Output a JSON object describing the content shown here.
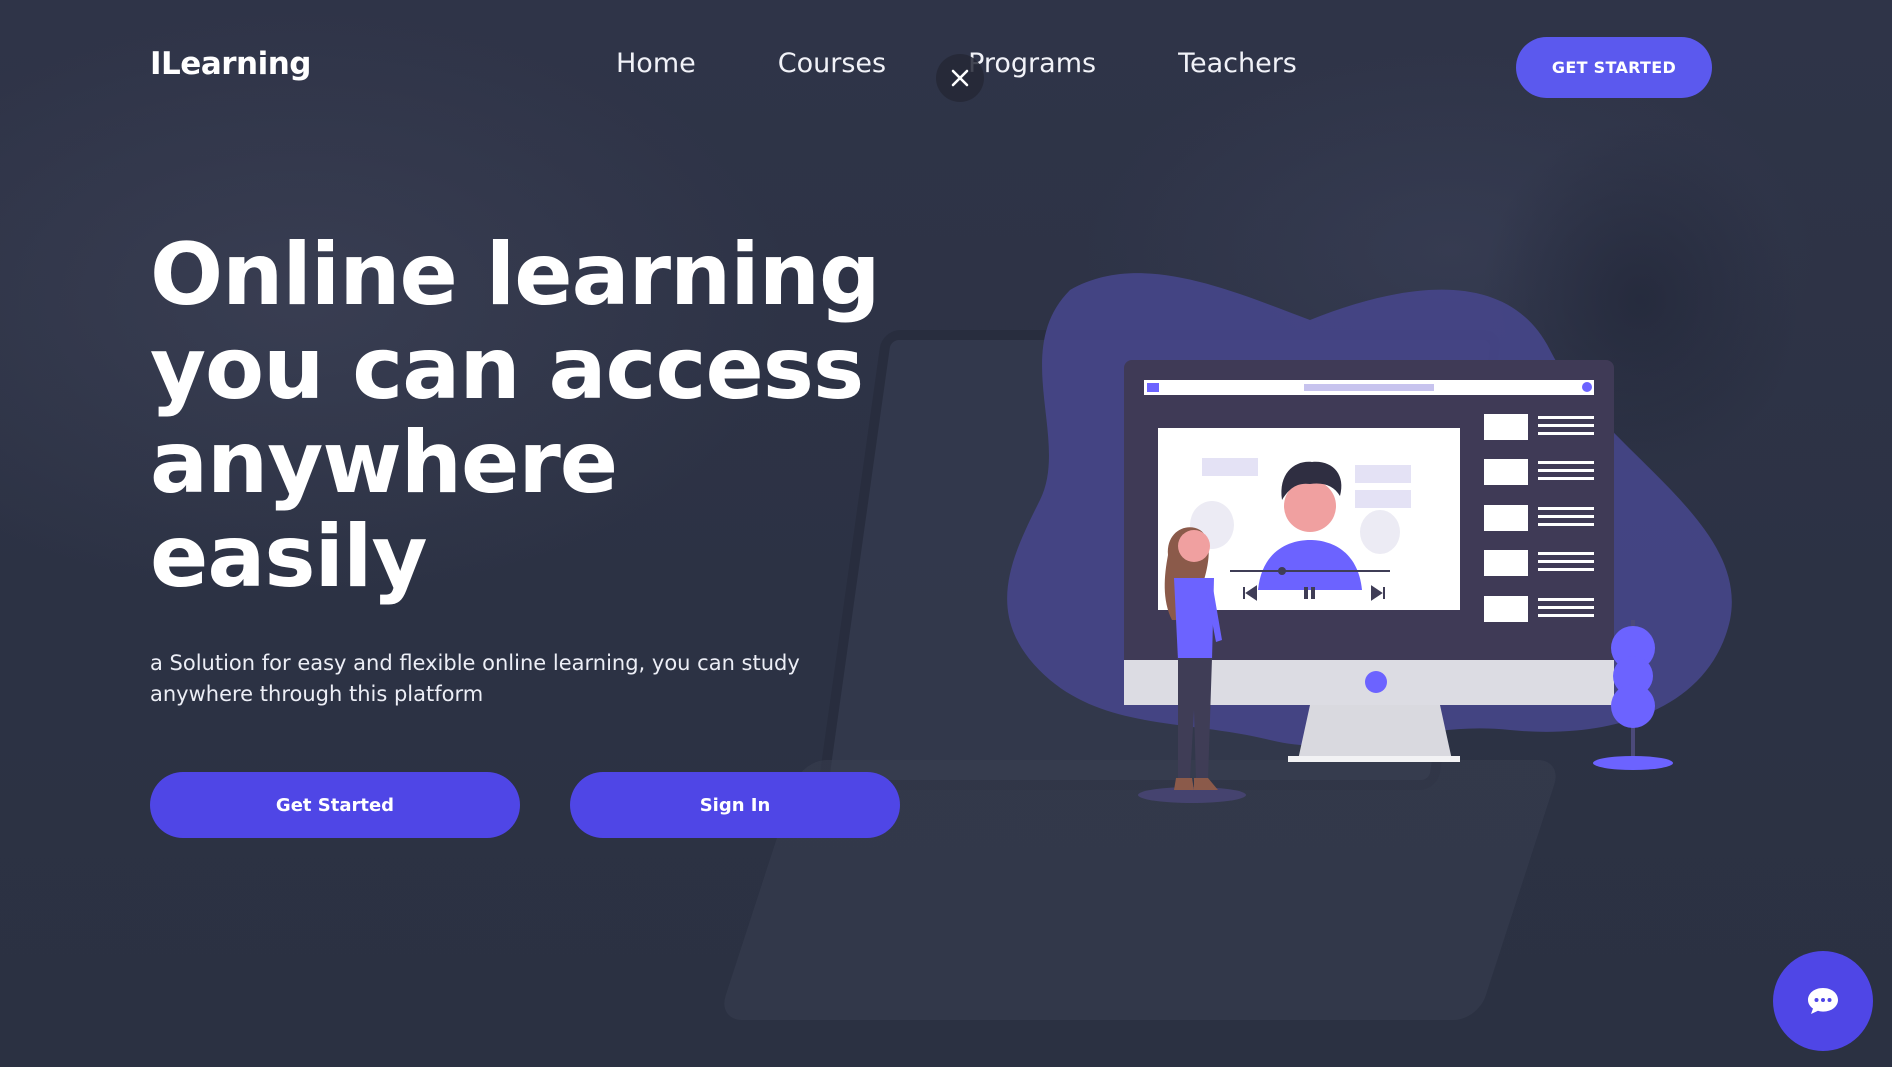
{
  "brand": {
    "logo": "ILearning"
  },
  "nav": {
    "links": [
      "Home",
      "Courses",
      "Programs",
      "Teachers"
    ],
    "cta_label": "GET STARTED"
  },
  "hero": {
    "title": "Online learning you can access anywhere easily",
    "subtitle": "a Solution for easy and flexible online learning, you can study anywhere through this platform",
    "primary_button": "Get Started",
    "secondary_button": "Sign In"
  },
  "icons": {
    "close": "close-icon",
    "chat": "chat-bubble-icon",
    "player_prev": "skip-back-icon",
    "player_pause": "pause-icon",
    "player_next": "skip-forward-icon"
  },
  "colors": {
    "accent": "#5b59ee",
    "button": "#4f46e6",
    "background": "#2d3346",
    "blob": "#46468a"
  }
}
